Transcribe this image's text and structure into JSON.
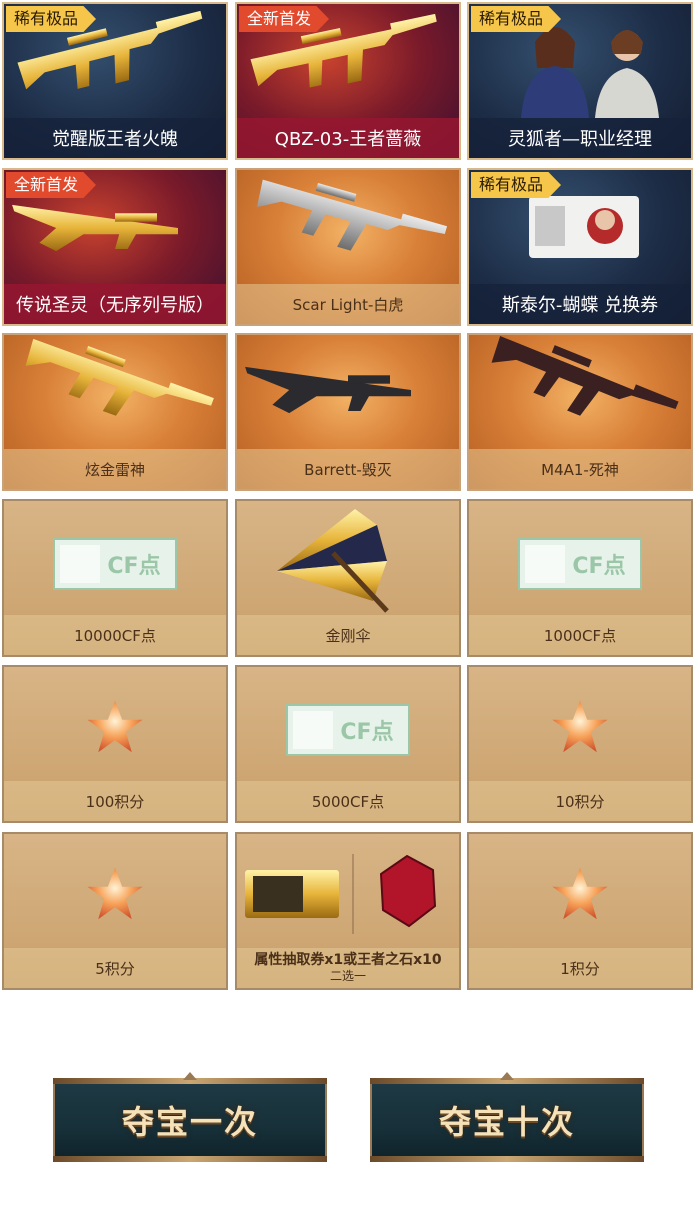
{
  "tags": {
    "rare": "稀有极品",
    "new": "全新首发"
  },
  "cf_label": "CF点",
  "prizes": [
    {
      "name": "觉醒版王者火魄",
      "tag": "稀有极品"
    },
    {
      "name": "QBZ-03-王者蔷薇",
      "tag": "全新首发"
    },
    {
      "name": "灵狐者—职业经理",
      "tag": "稀有极品"
    },
    {
      "name": "传说圣灵（无序列号版）",
      "tag": "全新首发"
    },
    {
      "name": "Scar Light-白虎",
      "tag": ""
    },
    {
      "name": "斯泰尔-蝴蝶 兑换券",
      "tag": "稀有极品"
    },
    {
      "name": "炫金雷神",
      "tag": ""
    },
    {
      "name": "Barrett-毁灭",
      "tag": ""
    },
    {
      "name": "M4A1-死神",
      "tag": ""
    },
    {
      "name": "10000CF点",
      "tag": ""
    },
    {
      "name": "金刚伞",
      "tag": ""
    },
    {
      "name": "1000CF点",
      "tag": ""
    },
    {
      "name": "100积分",
      "tag": ""
    },
    {
      "name": "5000CF点",
      "tag": ""
    },
    {
      "name": "10积分",
      "tag": ""
    },
    {
      "name": "5积分",
      "tag": ""
    },
    {
      "name": "属性抽取券x1或王者之石x10",
      "sub": "二选一",
      "tag": ""
    },
    {
      "name": "1积分",
      "tag": ""
    }
  ],
  "buttons": {
    "draw_once": "夺宝一次",
    "draw_ten": "夺宝十次"
  }
}
